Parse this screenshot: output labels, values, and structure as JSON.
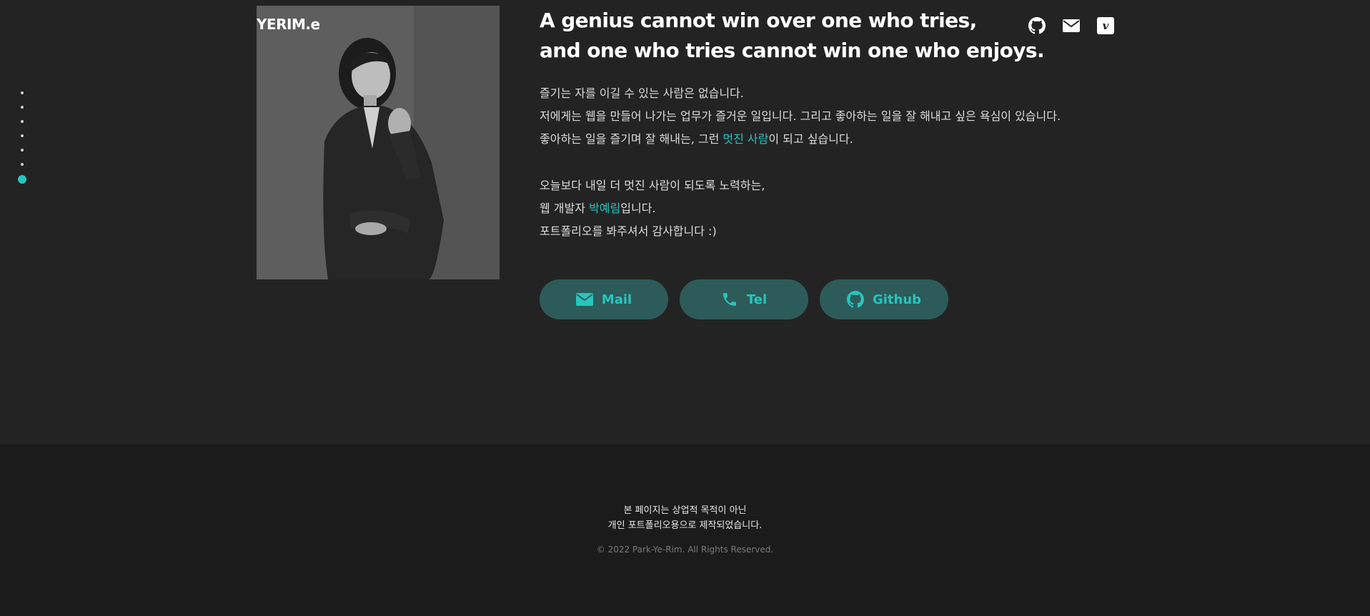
{
  "brand": {
    "logo_text": "YERIM.e"
  },
  "headline": {
    "line1": "A genius cannot win over one who tries,",
    "line2": "and one who tries cannot win one who enjoys."
  },
  "intro": {
    "line1": "즐기는 자를 이길 수 있는 사람은 없습니다.",
    "line2": "저에게는 웹을 만들어 나가는 업무가 즐거운 일입니다. 그리고 좋아하는 일을 잘 해내고 싶은 욕심이 있습니다.",
    "line3_prefix": "좋아하는 일을 즐기며 잘 해내는, 그런 ",
    "line3_highlight": "멋진 사람",
    "line3_suffix": "이 되고 싶습니다."
  },
  "outro": {
    "line1": "오늘보다 내일 더 멋진 사람이 되도록 노력하는,",
    "line2_prefix": "웹 개발자 ",
    "line2_highlight": "박예림",
    "line2_suffix": "입니다.",
    "line3": "포트폴리오를 봐주셔서 감사합니다 :)"
  },
  "social_icons": [
    "github-icon",
    "mail-icon",
    "vimeo-icon"
  ],
  "buttons": {
    "mail": "Mail",
    "tel": "Tel",
    "github": "Github"
  },
  "dotnav": {
    "count": 7,
    "active_index": 6
  },
  "footer": {
    "notice_line1": "본 페이지는 상업적 목적이 아닌",
    "notice_line2": "개인 포트폴리오용으로 제작되었습니다.",
    "copyright": "© 2022 Park-Ye-Rim. All Rights Reserved."
  },
  "colors": {
    "accent": "#27c5c0",
    "background": "#232323",
    "footer_bg": "#1b1b1b",
    "button_bg": "#2d5b59"
  }
}
